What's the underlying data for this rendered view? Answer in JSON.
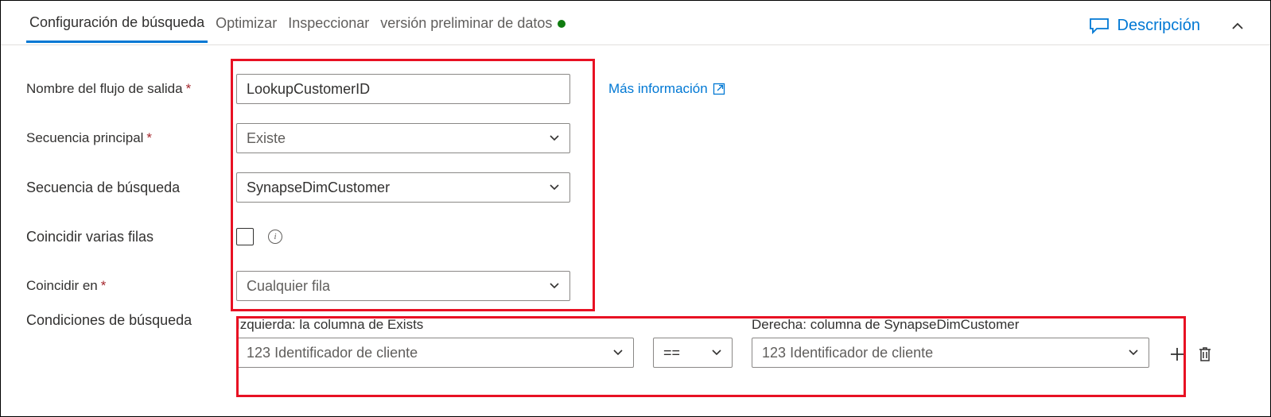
{
  "tabs": {
    "t0": "Configuración de búsqueda",
    "t1": "Optimizar",
    "t2": "Inspeccionar",
    "t3": "versión preliminar de datos"
  },
  "descLink": "Descripción",
  "labels": {
    "outputStream": "Nombre del flujo de salida",
    "primaryStream": "Secuencia principal",
    "lookupStream": "Secuencia de búsqueda",
    "matchMultiple": "Coincidir varias filas",
    "matchOn": "Coincidir en",
    "lookupConditions": "Condiciones de búsqueda"
  },
  "values": {
    "outputStream": "LookupCustomerID",
    "primaryStream": "Existe",
    "lookupStream": "SynapseDimCustomer",
    "matchOn": "Cualquier fila"
  },
  "moreInfo": "Más información",
  "conditions": {
    "leftHeader": "Izquierda: la columna de Exists",
    "rightHeader": "Derecha: columna de SynapseDimCustomer",
    "colPrefix": "123",
    "leftCol": "Identificador de cliente",
    "rightCol": "Identificador de cliente",
    "operator": "=="
  }
}
